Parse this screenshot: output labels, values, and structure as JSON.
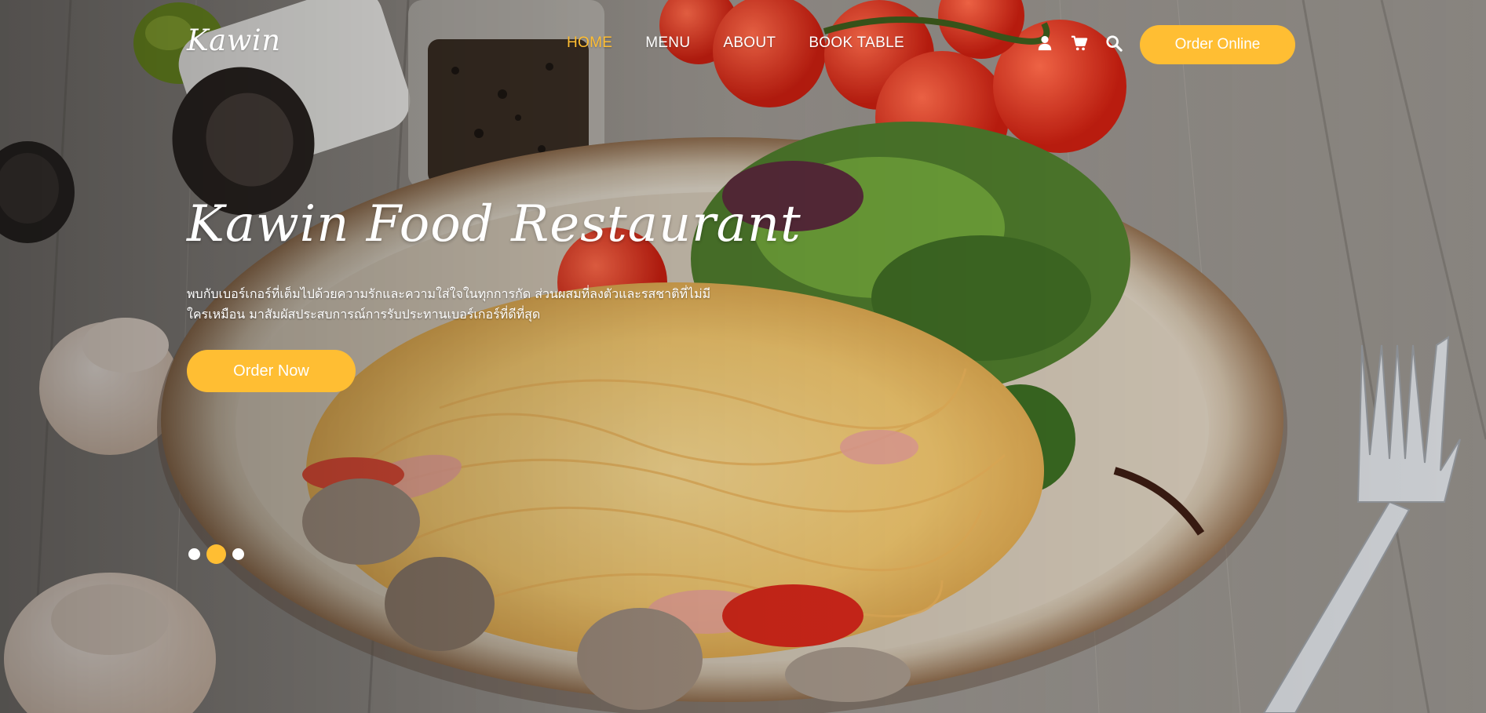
{
  "colors": {
    "accent": "#ffbe33",
    "text": "#ffffff"
  },
  "brand": {
    "logo": "Kawin"
  },
  "nav": {
    "items": [
      {
        "label": "HOME",
        "active": true
      },
      {
        "label": "MENU",
        "active": false
      },
      {
        "label": "ABOUT",
        "active": false
      },
      {
        "label": "BOOK TABLE",
        "active": false
      }
    ],
    "icons": [
      "user-icon",
      "cart-icon",
      "search-icon"
    ],
    "order_online_label": "Order Online"
  },
  "hero": {
    "title": "Kawin Food Restaurant",
    "description_line1": "พบกับเบอร์เกอร์ที่เต็มไปด้วยความรักและความใส่ใจในทุกการกัด ส่วนผสมที่ลงตัวและรสชาติที่ไม่มี",
    "description_line2": "ใครเหมือน มาสัมผัสประสบการณ์การรับประทานเบอร์เกอร์ที่ดีที่สุด",
    "cta_label": "Order Now"
  },
  "carousel": {
    "slide_count": 3,
    "active_index": 1
  }
}
